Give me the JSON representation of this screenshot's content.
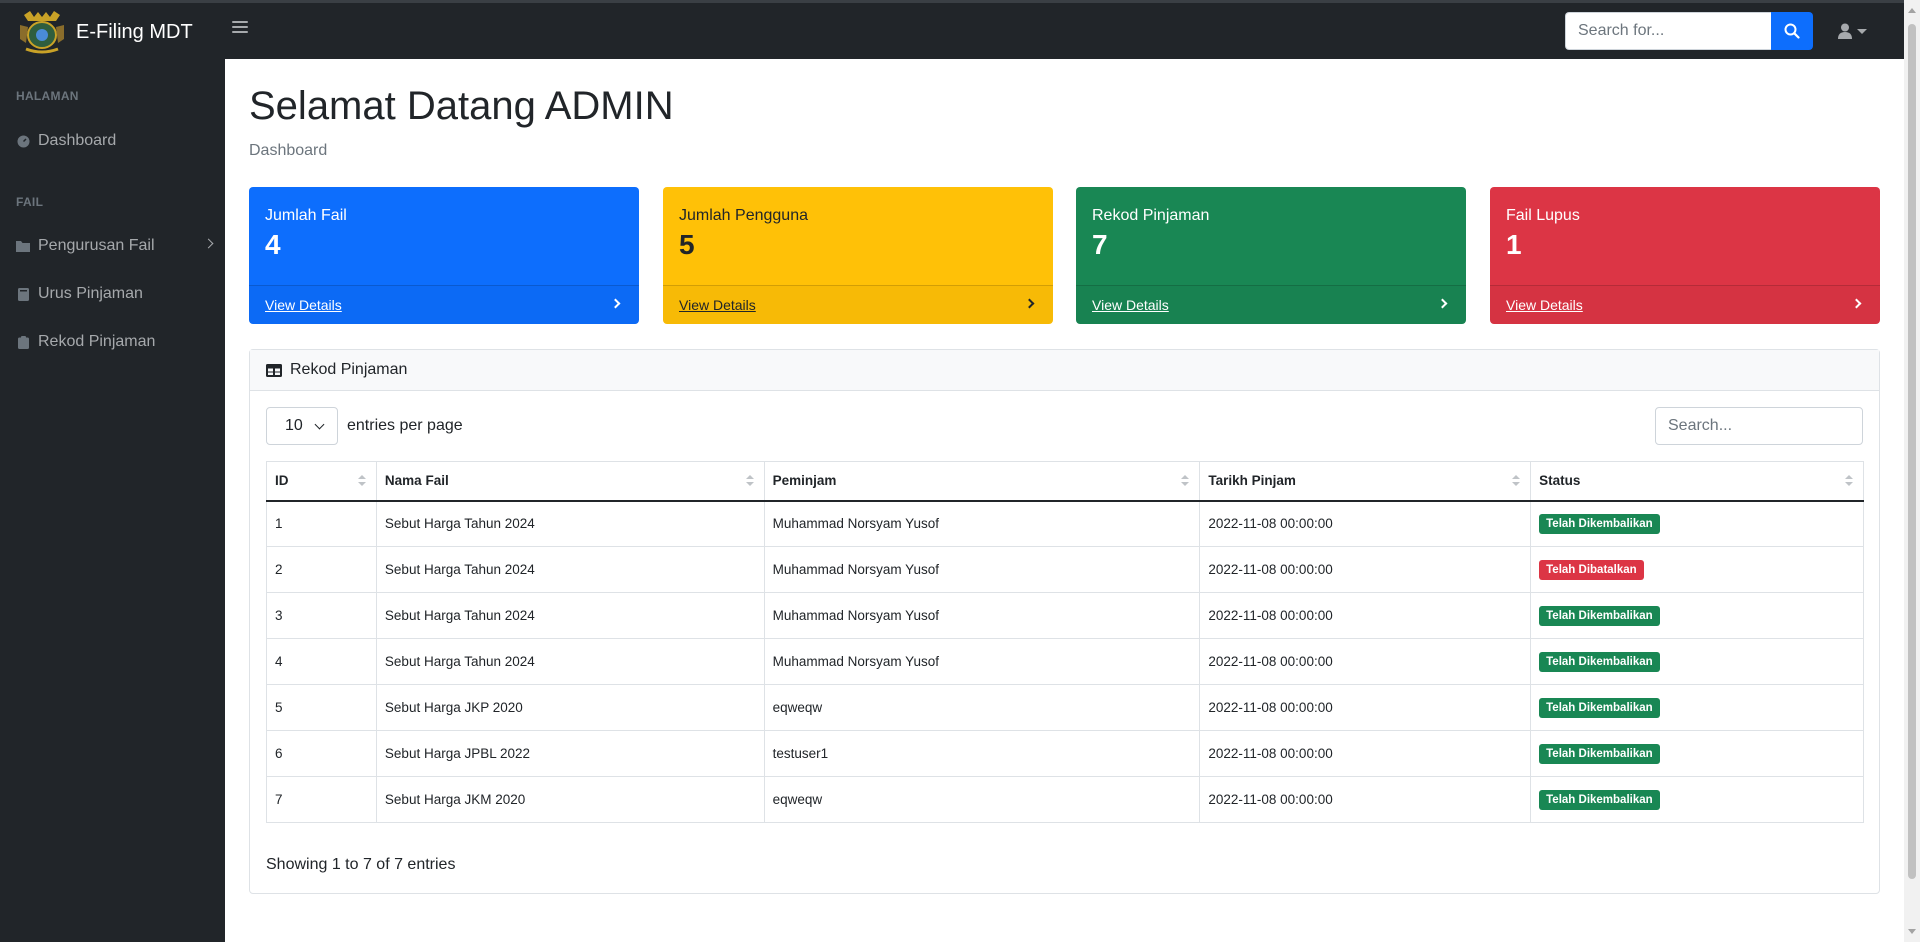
{
  "app": {
    "brand": "E-Filing MDT"
  },
  "topnav": {
    "search_placeholder": "Search for..."
  },
  "sidebar": {
    "headings": [
      "HALAMAN",
      "FAIL"
    ],
    "items": [
      {
        "label": "Dashboard",
        "icon": "dashboard-icon"
      },
      {
        "label": "Pengurusan Fail",
        "icon": "folder-icon"
      },
      {
        "label": "Urus Pinjaman",
        "icon": "book-icon"
      },
      {
        "label": "Rekod Pinjaman",
        "icon": "clipboard-icon"
      }
    ]
  },
  "main": {
    "title": "Selamat Datang ADMIN",
    "breadcrumb": "Dashboard"
  },
  "cards": [
    {
      "label": "Jumlah Fail",
      "value": "4",
      "link": "View Details",
      "color": "#0d6efd"
    },
    {
      "label": "Jumlah Pengguna",
      "value": "5",
      "link": "View Details",
      "color": "#ffc107"
    },
    {
      "label": "Rekod Pinjaman",
      "value": "7",
      "link": "View Details",
      "color": "#198754"
    },
    {
      "label": "Fail Lupus",
      "value": "1",
      "link": "View Details",
      "color": "#dc3545"
    }
  ],
  "table_card": {
    "title": "Rekod Pinjaman",
    "per_page_value": "10",
    "per_page_label": "entries per page",
    "search_placeholder": "Search...",
    "columns": [
      "ID",
      "Nama Fail",
      "Peminjam",
      "Tarikh Pinjam",
      "Status"
    ],
    "rows": [
      {
        "id": "1",
        "nama_fail": "Sebut Harga Tahun 2024",
        "peminjam": "Muhammad Norsyam Yusof",
        "tarikh": "2022-11-08 00:00:00",
        "status": "Telah Dikembalikan",
        "status_color": "#198754"
      },
      {
        "id": "2",
        "nama_fail": "Sebut Harga Tahun 2024",
        "peminjam": "Muhammad Norsyam Yusof",
        "tarikh": "2022-11-08 00:00:00",
        "status": "Telah Dibatalkan",
        "status_color": "#dc3545"
      },
      {
        "id": "3",
        "nama_fail": "Sebut Harga Tahun 2024",
        "peminjam": "Muhammad Norsyam Yusof",
        "tarikh": "2022-11-08 00:00:00",
        "status": "Telah Dikembalikan",
        "status_color": "#198754"
      },
      {
        "id": "4",
        "nama_fail": "Sebut Harga Tahun 2024",
        "peminjam": "Muhammad Norsyam Yusof",
        "tarikh": "2022-11-08 00:00:00",
        "status": "Telah Dikembalikan",
        "status_color": "#198754"
      },
      {
        "id": "5",
        "nama_fail": "Sebut Harga JKP 2020",
        "peminjam": "eqweqw",
        "tarikh": "2022-11-08 00:00:00",
        "status": "Telah Dikembalikan",
        "status_color": "#198754"
      },
      {
        "id": "6",
        "nama_fail": "Sebut Harga JPBL 2022",
        "peminjam": "testuser1",
        "tarikh": "2022-11-08 00:00:00",
        "status": "Telah Dikembalikan",
        "status_color": "#198754"
      },
      {
        "id": "7",
        "nama_fail": "Sebut Harga JKM 2020",
        "peminjam": "eqweqw",
        "tarikh": "2022-11-08 00:00:00",
        "status": "Telah Dikembalikan",
        "status_color": "#198754"
      }
    ],
    "info": "Showing 1 to 7 of 7 entries"
  }
}
